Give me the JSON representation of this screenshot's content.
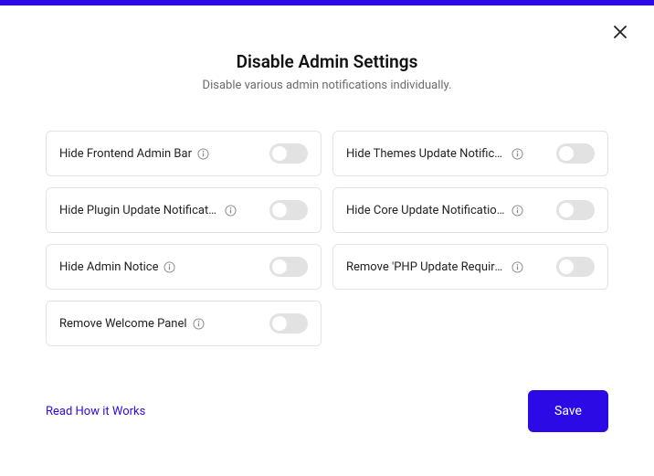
{
  "header": {
    "title": "Disable Admin Settings",
    "subtitle": "Disable various admin notifications individually."
  },
  "settings": [
    {
      "label": "Hide Frontend Admin Bar"
    },
    {
      "label": "Hide Themes Update Notifications"
    },
    {
      "label": "Hide Plugin Update Notifications"
    },
    {
      "label": "Hide Core Update Notifications"
    },
    {
      "label": "Hide Admin Notice"
    },
    {
      "label": "Remove 'PHP Update Required' Dashboard Widget"
    },
    {
      "label": "Remove Welcome Panel"
    }
  ],
  "footer": {
    "link": "Read How it Works",
    "save": "Save"
  },
  "colors": {
    "accent": "#2c0ae6"
  }
}
